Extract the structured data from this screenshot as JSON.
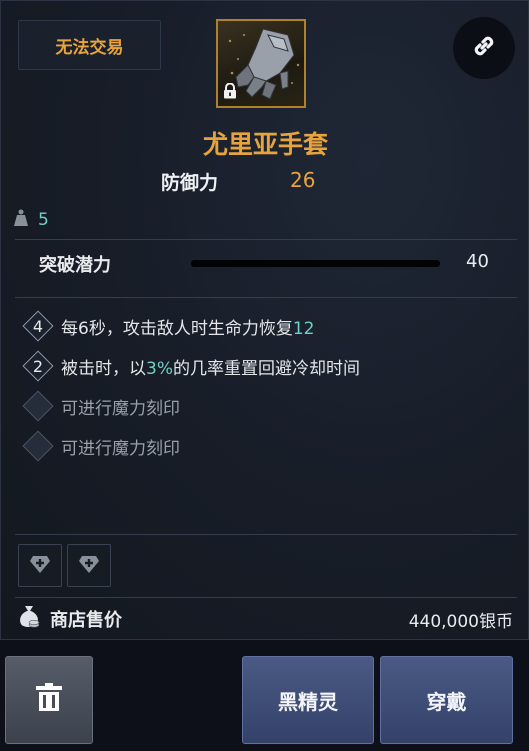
{
  "header": {
    "untradeable_label": "无法交易",
    "link_icon": "link-icon"
  },
  "item": {
    "name": "尤里亚手套",
    "icon": "gauntlet-icon",
    "lock_icon": "lock-icon",
    "defense_label": "防御力",
    "defense_value": "26",
    "weight_icon": "weight-icon",
    "weight_value": "5"
  },
  "breakthrough": {
    "label": "突破潜力",
    "value": "40",
    "progress": 0
  },
  "effects": [
    {
      "badge": "4",
      "before": "每",
      "hl1": "6",
      "mid": "秒，攻击敌人时生命力恢复",
      "hl2": "12",
      "after": ""
    },
    {
      "badge": "2",
      "before": "被击时，以",
      "hl1": "3%",
      "mid": "的几率重置回避冷却时间",
      "hl2": "",
      "after": ""
    }
  ],
  "engrave_slots": [
    "可进行魔力刻印",
    "可进行魔力刻印"
  ],
  "sockets": [
    "gem-socket-icon",
    "gem-socket-icon"
  ],
  "price": {
    "icon": "money-bag-icon",
    "label": "商店售价",
    "value": "440,000银币"
  },
  "buttons": {
    "trash_icon": "trash-icon",
    "dark_elf_label": "黑精灵",
    "equip_label": "穿戴"
  },
  "colors": {
    "accent_gold": "#e8a33c",
    "highlight_teal": "#6fd0c6",
    "button_blue": "#3c4a74"
  }
}
